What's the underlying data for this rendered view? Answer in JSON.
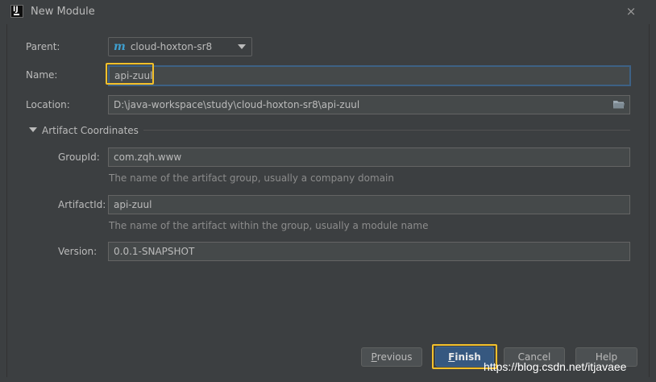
{
  "window": {
    "title": "New Module",
    "close_glyph": "×"
  },
  "form": {
    "parent_label": "Parent:",
    "parent_icon": "m",
    "parent_value": "cloud-hoxton-sr8",
    "name_label": "Name:",
    "name_value": "api-zuul",
    "location_label": "Location:",
    "location_value": "D:\\java-workspace\\study\\cloud-hoxton-sr8\\api-zuul",
    "section_title": "Artifact Coordinates",
    "groupid_label": "GroupId:",
    "groupid_value": "com.zqh.www",
    "groupid_hint": "The name of the artifact group, usually a company domain",
    "artifactid_label": "ArtifactId:",
    "artifactid_value": "api-zuul",
    "artifactid_hint": "The name of the artifact within the group, usually a module name",
    "version_label": "Version:",
    "version_value": "0.0.1-SNAPSHOT"
  },
  "buttons": {
    "previous_mnemonic": "P",
    "previous_rest": "revious",
    "finish_mnemonic": "F",
    "finish_rest": "inish",
    "cancel_label": "Cancel",
    "help_label": "Help"
  },
  "watermark": "https://blog.csdn.net/itjavaee",
  "colors": {
    "background": "#3c3f41",
    "field_background": "#45494a",
    "focus_border": "#3d6185",
    "primary_button": "#365880",
    "annotation_highlight": "#f4c02a"
  }
}
